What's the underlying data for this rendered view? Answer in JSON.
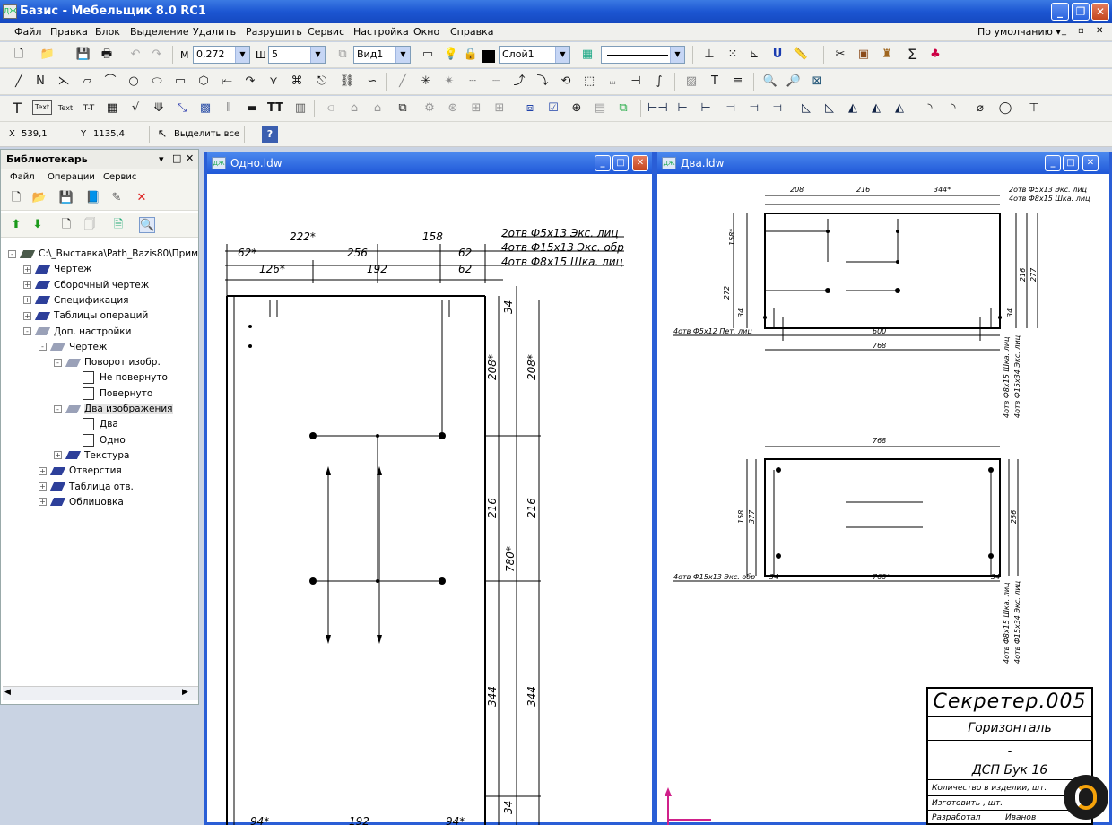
{
  "app": {
    "title": "Базис - Мебельщик 8.0 RC1",
    "icon": "ДЖ"
  },
  "menu": [
    "Файл",
    "Правка",
    "Блок",
    "Выделение",
    "Удалить",
    "Разрушить",
    "Сервис",
    "Настройка",
    "Окно",
    "Справка"
  ],
  "menu_right": "По умолчанию ▾",
  "toolbar": {
    "m_label": "М",
    "m_value": "0,272",
    "w_label": "Ш",
    "w_value": "5",
    "view": "Вид1",
    "layer": "Слой1"
  },
  "text_tools": [
    "T",
    "Text",
    "Text",
    "T-T",
    "TT"
  ],
  "coords": {
    "x_label": "X",
    "x_value": "539,1",
    "y_label": "Y",
    "y_value": "1135,4",
    "select_all": "Выделить все"
  },
  "library": {
    "title": "Библиотекарь",
    "menu": [
      "Файл",
      "Операции",
      "Сервис"
    ],
    "tree": [
      {
        "label": "C:\\_Выставка\\Path_Bazis80\\Приме",
        "depth": 0,
        "exp": "-",
        "icon": "root"
      },
      {
        "label": "Чертеж",
        "depth": 1,
        "exp": "+",
        "icon": "book"
      },
      {
        "label": "Сборочный чертеж",
        "depth": 1,
        "exp": "+",
        "icon": "book"
      },
      {
        "label": "Спецификация",
        "depth": 1,
        "exp": "+",
        "icon": "book"
      },
      {
        "label": "Таблицы операций",
        "depth": 1,
        "exp": "+",
        "icon": "book"
      },
      {
        "label": "Доп. настройки",
        "depth": 1,
        "exp": "-",
        "icon": "bookg"
      },
      {
        "label": "Чертеж",
        "depth": 2,
        "exp": "-",
        "icon": "bookg"
      },
      {
        "label": "Поворот изобр.",
        "depth": 3,
        "exp": "-",
        "icon": "bookg"
      },
      {
        "label": "Не повернуто",
        "depth": 4,
        "exp": "",
        "icon": "doc"
      },
      {
        "label": "Повернуто",
        "depth": 4,
        "exp": "",
        "icon": "doc"
      },
      {
        "label": "Два изображения",
        "depth": 3,
        "exp": "-",
        "icon": "bookg",
        "sel": true
      },
      {
        "label": "Два",
        "depth": 4,
        "exp": "",
        "icon": "doc"
      },
      {
        "label": "Одно",
        "depth": 4,
        "exp": "",
        "icon": "doc"
      },
      {
        "label": "Текстура",
        "depth": 3,
        "exp": "+",
        "icon": "book"
      },
      {
        "label": "Отверстия",
        "depth": 2,
        "exp": "+",
        "icon": "book"
      },
      {
        "label": "Таблица отв.",
        "depth": 2,
        "exp": "+",
        "icon": "book"
      },
      {
        "label": "Облицовка",
        "depth": 2,
        "exp": "+",
        "icon": "book"
      }
    ]
  },
  "doc1": {
    "title": "Одно.ldw",
    "dims": [
      "222*",
      "158",
      "62*",
      "256",
      "62",
      "126*",
      "192",
      "62",
      "34",
      "208*",
      "208*",
      "216",
      "216",
      "780*",
      "344",
      "344",
      "34",
      "94*",
      "192",
      "94*"
    ],
    "notes": [
      "2отв Ф5х13 Экс. лиц",
      "4отв Ф15х13 Экс. обр",
      "4отв Ф8х15 Шка. лиц"
    ]
  },
  "doc2": {
    "title": "Два.ldw",
    "dims": [
      "208",
      "216",
      "344*",
      "158*",
      "272",
      "34",
      "34",
      "216",
      "277",
      "600",
      "768",
      "768",
      "158",
      "377",
      "34",
      "34",
      "256",
      "768*"
    ],
    "notes": [
      "2отв Ф5х13 Экс. лиц",
      "4отв Ф8х15 Шка. лиц",
      "4отв Ф5х12 Пет. лиц",
      "4отв Ф8х15 Шка. лиц",
      "4отв Ф15х34 Экс. лиц",
      "4отв Ф15х13 Экс. обр",
      "4отв Ф8х15 Шка. лиц",
      "4отв Ф15х34 Экс. лиц"
    ]
  },
  "stamp": {
    "name": "Секретер.005",
    "part": "Горизонталь",
    "dash": "-",
    "material": "ДСП Бук 16",
    "qty": "Количество в изделии, шт.",
    "made": "Изготовить , шт.",
    "dev": "Разработал",
    "dev_name": "Иванов"
  },
  "colors": {
    "title_bar": "#1c56d2",
    "selection": "#2a5ed6",
    "brand": "#f5a20a"
  }
}
